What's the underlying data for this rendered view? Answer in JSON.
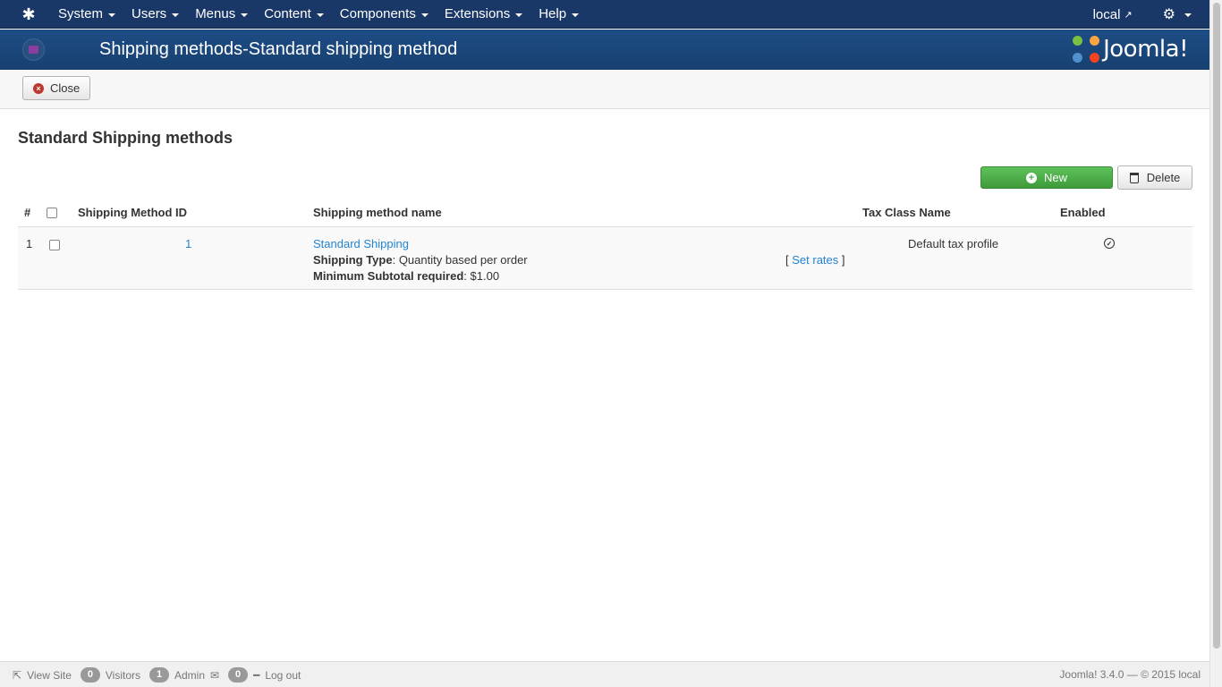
{
  "navbar": {
    "logo_icon": "joomla-icon",
    "items": [
      {
        "label": "System"
      },
      {
        "label": "Users"
      },
      {
        "label": "Menus"
      },
      {
        "label": "Content"
      },
      {
        "label": "Components"
      },
      {
        "label": "Extensions"
      },
      {
        "label": "Help"
      }
    ],
    "site_label": "local",
    "settings_icon": "gear-icon"
  },
  "header": {
    "title": "Shipping methods-Standard shipping method",
    "brand": "Joomla!"
  },
  "toolbar": {
    "close_label": "Close"
  },
  "page": {
    "heading": "Standard Shipping methods",
    "new_label": "New",
    "delete_label": "Delete"
  },
  "table": {
    "columns": {
      "num": "#",
      "id": "Shipping Method ID",
      "name": "Shipping method name",
      "tax": "Tax Class Name",
      "enabled": "Enabled"
    },
    "rows": [
      {
        "num": "1",
        "id": "1",
        "name": "Standard Shipping",
        "type_label": "Shipping Type",
        "type_value": ": Quantity based per order",
        "min_label": "Minimum Subtotal required",
        "min_value": ": $1.00",
        "set_rates_open": "[",
        "set_rates": "Set rates",
        "set_rates_close": "]",
        "tax": "Default tax profile",
        "enabled": true
      }
    ]
  },
  "footer": {
    "view_site": "View Site",
    "visitors_count": "0",
    "visitors_label": "Visitors",
    "admin_count": "1",
    "admin_label": "Admin",
    "messages_count": "0",
    "logout": "Log out",
    "version": "Joomla! 3.4.0  —  © 2015 local"
  }
}
